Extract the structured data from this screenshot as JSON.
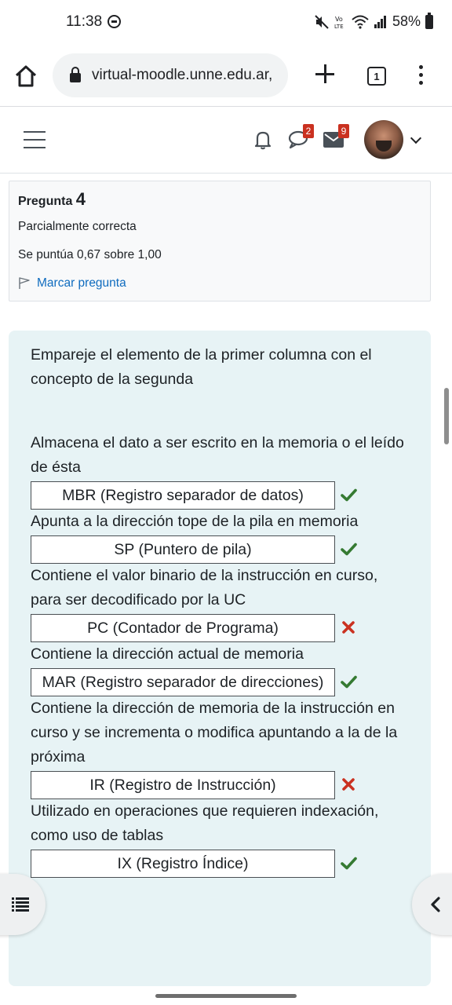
{
  "status_bar": {
    "time": "11:38",
    "battery": "58%"
  },
  "browser": {
    "url": "virtual-moodle.unne.edu.ar,",
    "tab_count": "1"
  },
  "header": {
    "chat_badge": "2",
    "mail_badge": "9"
  },
  "question_info": {
    "title_label": "Pregunta",
    "number": "4",
    "state": "Parcialmente correcta",
    "grade": "Se puntúa 0,67 sobre 1,00",
    "flag_label": "Marcar pregunta"
  },
  "question": {
    "prompt": "Empareje el elemento de la primer columna con el concepto de la segunda",
    "pairs": [
      {
        "stem": "Almacena el dato a ser escrito en la memoria o el leído de ésta",
        "answer": "MBR (Registro separador de datos)",
        "result": "correct"
      },
      {
        "stem": "Apunta a la dirección tope de la pila en memoria",
        "answer": "SP (Puntero de pila)",
        "result": "correct"
      },
      {
        "stem": "Contiene el valor binario de la instrucción en curso, para ser decodificado por la UC",
        "answer": "PC (Contador de Programa)",
        "result": "incorrect"
      },
      {
        "stem": "Contiene la dirección actual de memoria",
        "answer": "MAR (Registro separador de direcciones)",
        "result": "correct"
      },
      {
        "stem": "Contiene la dirección de memoria de la instrucción en curso y se incrementa o modifica apuntando a la de la próxima",
        "answer": "IR (Registro de Instrucción)",
        "result": "incorrect"
      },
      {
        "stem": "Utilizado en operaciones que requieren indexación, como uso de tablas",
        "answer": "IX (Registro Índice)",
        "result": "correct"
      }
    ]
  },
  "colors": {
    "correct": "#357a32",
    "incorrect": "#ca3120",
    "link": "#0f6cbf",
    "content_bg": "#e7f3f5"
  }
}
